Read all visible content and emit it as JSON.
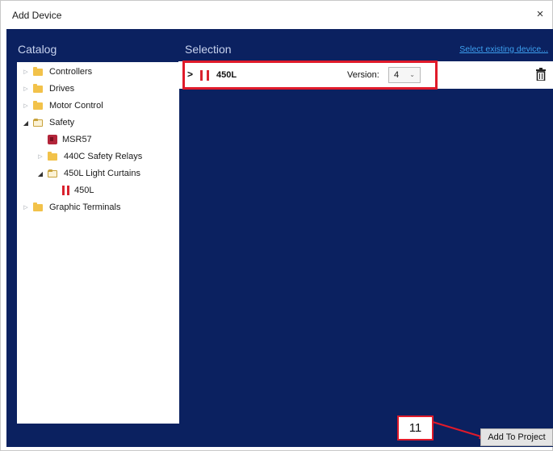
{
  "window": {
    "title": "Add Device",
    "close_glyph": "×"
  },
  "catalog": {
    "header": "Catalog",
    "items": [
      {
        "label": "Controllers",
        "icon": "folder-icon",
        "expanded": false
      },
      {
        "label": "Drives",
        "icon": "folder-icon",
        "expanded": false
      },
      {
        "label": "Motor Control",
        "icon": "folder-icon",
        "expanded": false
      },
      {
        "label": "Safety",
        "icon": "open-folder-icon",
        "expanded": true
      },
      {
        "label": "MSR57",
        "icon": "safety-relay-icon"
      },
      {
        "label": "440C Safety Relays",
        "icon": "folder-icon",
        "expanded": false
      },
      {
        "label": "450L Light Curtains",
        "icon": "open-folder-icon",
        "expanded": true
      },
      {
        "label": "450L",
        "icon": "light-curtain-icon"
      },
      {
        "label": "Graphic Terminals",
        "icon": "folder-icon",
        "expanded": false
      }
    ]
  },
  "selection": {
    "header": "Selection",
    "select_existing_link": "Select existing device...",
    "device": {
      "name": "450L",
      "version_label": "Version:",
      "version_value": "4"
    }
  },
  "callout": {
    "number": "11",
    "color": "#e01a2a"
  },
  "footer": {
    "add_button": "Add To Project"
  },
  "colors": {
    "panel_bg": "#0b2160",
    "link": "#3da0f0",
    "accent_red": "#e01a2a"
  }
}
